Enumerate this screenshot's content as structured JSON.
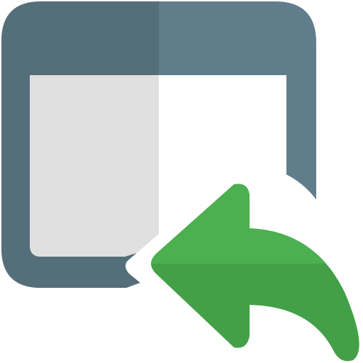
{
  "icon": {
    "name": "browser-window-reply-icon",
    "window_name": "browser-window-icon",
    "arrow_name": "reply-arrow-icon"
  },
  "colors": {
    "background": "#ffffff",
    "frame_dark": "#546e7a",
    "frame_light": "#607d8b",
    "content_left": "#e0e0e0",
    "content_right": "#ffffff",
    "arrow_light": "#4caf50",
    "arrow_dark": "#43a047",
    "separator": "#ffffff"
  }
}
